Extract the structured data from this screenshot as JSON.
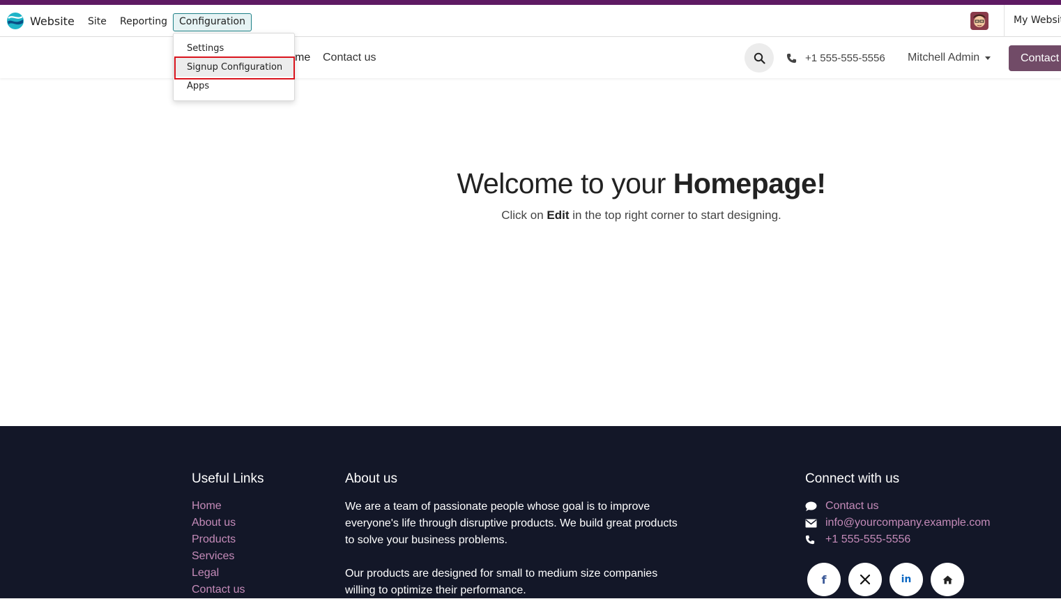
{
  "topbar": {
    "app_name": "Website",
    "menus": [
      "Site",
      "Reporting",
      "Configuration"
    ],
    "website_selector": "My Website"
  },
  "dropdown": {
    "items": [
      "Settings",
      "Signup Configuration",
      "Apps"
    ]
  },
  "site_nav": {
    "home_partial": "me",
    "contact_link": "Contact us",
    "phone": "+1 555-555-5556",
    "user": "Mitchell Admin",
    "contact_button": "Contact"
  },
  "hero": {
    "title_prefix": "Welcome to your ",
    "title_bold": "Homepage!",
    "sub_prefix": "Click on ",
    "sub_bold": "Edit",
    "sub_suffix": " in the top right corner to start designing."
  },
  "footer": {
    "useful_links_title": "Useful Links",
    "useful_links": [
      "Home",
      "About us",
      "Products",
      "Services",
      "Legal",
      "Contact us"
    ],
    "about_title": "About us",
    "about_lines": [
      "We are a team of passionate people whose goal is to improve",
      "everyone's life through disruptive products. We build great products",
      "to solve your business problems.",
      "Our products are designed for small to medium size companies",
      "willing to optimize their performance."
    ],
    "connect_title": "Connect with us",
    "connect_contact": "Contact us",
    "connect_email": "info@yourcompany.example.com",
    "connect_phone": "+1 555-555-5556",
    "social_icons": [
      "facebook-icon",
      "x-icon",
      "linkedin-icon",
      "home-icon"
    ]
  },
  "colors": {
    "brand_purple": "#714b67",
    "footer_bg": "#131728",
    "footer_link": "#c58bb9",
    "highlight_red": "#d9131c"
  }
}
